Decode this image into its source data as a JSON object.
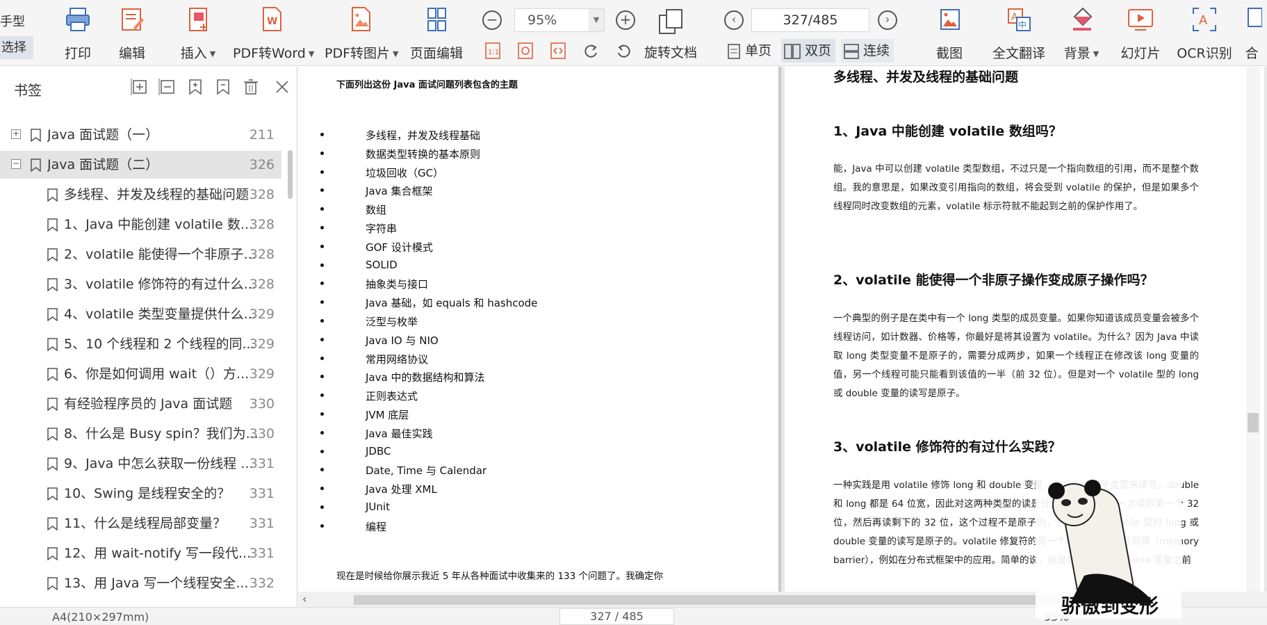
{
  "toolbar": {
    "left_stub": {
      "top": "手型",
      "bottom": "选择"
    },
    "print": "打印",
    "edit": "编辑",
    "insert": "插入",
    "pdf_to_word": "PDF转Word",
    "pdf_to_image": "PDF转图片",
    "page_edit": "页面编辑",
    "zoom_value": "95%",
    "page_indicator": "327/485",
    "rotate_doc": "旋转文档",
    "single_page": "单页",
    "double_page": "双页",
    "continuous": "连续",
    "screenshot": "截图",
    "full_translate": "全文翻译",
    "background": "背景",
    "slideshow": "幻灯片",
    "ocr": "OCR识别",
    "merge_partial": "合",
    "active_view": "双页"
  },
  "sidebar": {
    "title": "书签",
    "items": [
      {
        "label": "Java 面试题（一）",
        "page": "211",
        "level": 0,
        "expander": "+"
      },
      {
        "label": "Java 面试题（二）",
        "page": "326",
        "level": 0,
        "expander": "−",
        "selected": true
      },
      {
        "label": "多线程、并发及线程的基础问题",
        "page": "328",
        "level": 1
      },
      {
        "label": "1、Java 中能创建 volatile 数...",
        "page": "328",
        "level": 1
      },
      {
        "label": "2、volatile 能使得一个非原子...",
        "page": "328",
        "level": 1
      },
      {
        "label": "3、volatile 修饰符的有过什么...",
        "page": "328",
        "level": 1
      },
      {
        "label": "4、volatile 类型变量提供什么...",
        "page": "329",
        "level": 1
      },
      {
        "label": "5、10 个线程和 2 个线程的同...",
        "page": "329",
        "level": 1
      },
      {
        "label": "6、你是如何调用 wait（）方...",
        "page": "329",
        "level": 1
      },
      {
        "label": "有经验程序员的 Java 面试题",
        "page": "330",
        "level": 1
      },
      {
        "label": "8、什么是 Busy spin？我们为...",
        "page": "330",
        "level": 1
      },
      {
        "label": "9、Java 中怎么获取一份线程 ...",
        "page": "331",
        "level": 1
      },
      {
        "label": "10、Swing 是线程安全的？",
        "page": "331",
        "level": 1
      },
      {
        "label": "11、什么是线程局部变量？",
        "page": "331",
        "level": 1
      },
      {
        "label": "12、用 wait-notify 写一段代...",
        "page": "331",
        "level": 1
      },
      {
        "label": "13、用 Java 写一个线程安全...",
        "page": "332",
        "level": 1
      }
    ]
  },
  "left_page": {
    "heading": "下面列出这份 Java 面试问题列表包含的主题",
    "topics": [
      "多线程，并发及线程基础",
      "数据类型转换的基本原则",
      "垃圾回收（GC）",
      "Java 集合框架",
      "数组",
      "字符串",
      "GOF 设计模式",
      "SOLID",
      "抽象类与接口",
      "Java 基础，如 equals 和 hashcode",
      "泛型与枚举",
      "Java IO 与 NIO",
      "常用网络协议",
      "Java 中的数据结构和算法",
      "正则表达式",
      "JVM 底层",
      "Java 最佳实践",
      "JDBC",
      "Date, Time 与 Calendar",
      "Java 处理 XML",
      "JUnit",
      "编程"
    ],
    "footer": "现在是时候给你展示我近 5 年从各种面试中收集来的 133 个问题了。我确定你"
  },
  "right_page": {
    "section_title": "多线程、并发及线程的基础问题",
    "q1_title": "1、Java 中能创建 volatile 数组吗？",
    "q1_body": "能，Java 中可以创建 volatile 类型数组，不过只是一个指向数组的引用，而不是整个数组。我的意思是，如果改变引用指向的数组，将会受到 volatile 的保护，但是如果多个线程同时改变数组的元素，volatile 标示符就不能起到之前的保护作用了。",
    "q2_title": "2、volatile 能使得一个非原子操作变成原子操作吗？",
    "q2_body": "一个典型的例子是在类中有一个 long 类型的成员变量。如果你知道该成员变量会被多个线程访问，如计数器、价格等，你最好是将其设置为 volatile。为什么？因为 Java 中读取 long 类型变量不是原子的，需要分成两步，如果一个线程正在修改该 long 变量的值，另一个线程可能只能看到该值的一半（前 32 位）。但是对一个 volatile 型的 long 或 double 变量的读写是原子。",
    "q3_title": "3、volatile 修饰符的有过什么实践？",
    "q3_body": "一种实践是用 volatile 修饰 long 和 double 变量，使其能按原子类型来读写。double 和 long 都是 64 位宽，因此对这两种类型的读是分为两部分的，第一次读取第一个 32 位，然后再读剩下的 32 位，这个过程不是原子的，但 Java 中 volatile 型的 long 或 double 变量的读写是原子的。volatile 修复符的另一个作用是提供内存屏障（memory barrier），例如在分布式框架中的应用。简单的说，就是当你写一个 volatile 变量之前"
  },
  "statusbar": {
    "paper": "A4(210×297mm)",
    "page": "327 / 485",
    "zoom": "95%"
  },
  "sticker": {
    "caption": "骄傲到变形"
  }
}
